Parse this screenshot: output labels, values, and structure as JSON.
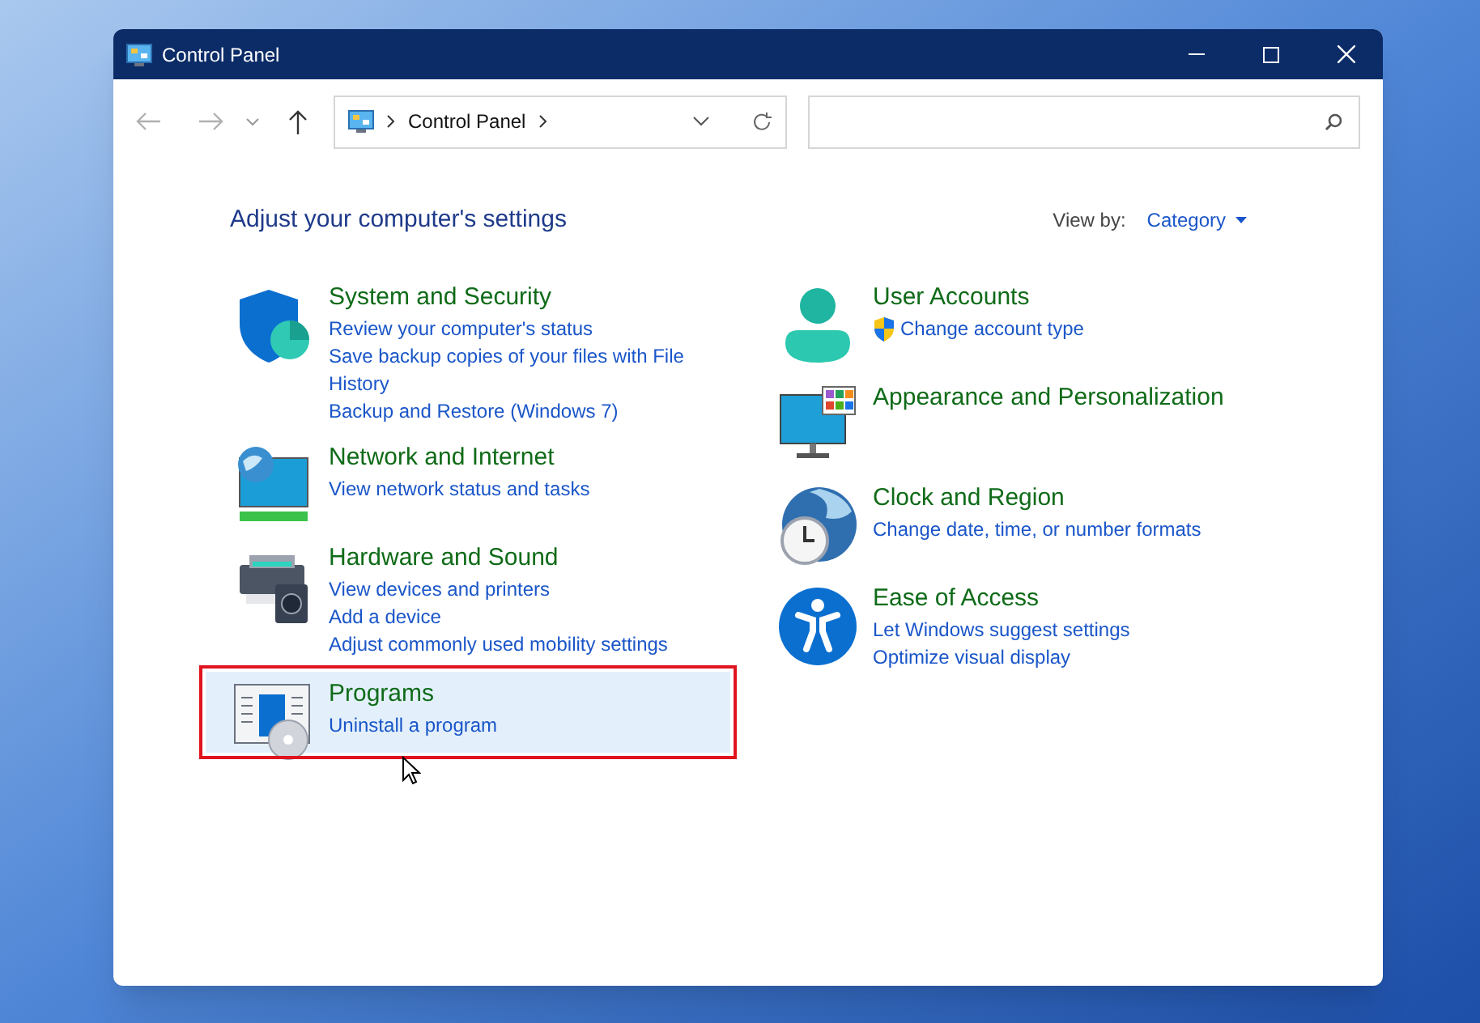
{
  "window": {
    "title": "Control Panel"
  },
  "address_bar": {
    "path": "Control Panel"
  },
  "heading": "Adjust your computer's settings",
  "view_by": {
    "label": "View by:",
    "value": "Category"
  },
  "columns": [
    {
      "categories": [
        {
          "title": "System and Security",
          "selected": false,
          "links": [
            {
              "text": "Review your computer's status",
              "shield": false
            },
            {
              "text": "Save backup copies of your files with File History",
              "shield": false
            },
            {
              "text": "Backup and Restore (Windows 7)",
              "shield": false
            }
          ]
        },
        {
          "title": "Network and Internet",
          "selected": false,
          "links": [
            {
              "text": "View network status and tasks",
              "shield": false
            }
          ]
        },
        {
          "title": "Hardware and Sound",
          "selected": false,
          "links": [
            {
              "text": "View devices and printers",
              "shield": false
            },
            {
              "text": "Add a device",
              "shield": false
            },
            {
              "text": "Adjust commonly used mobility settings",
              "shield": false
            }
          ]
        },
        {
          "title": "Programs",
          "selected": true,
          "links": [
            {
              "text": "Uninstall a program",
              "shield": false
            }
          ]
        }
      ]
    },
    {
      "categories": [
        {
          "title": "User Accounts",
          "selected": false,
          "links": [
            {
              "text": "Change account type",
              "shield": true
            }
          ]
        },
        {
          "title": "Appearance and Personalization",
          "selected": false
        },
        {
          "title": "Clock and Region",
          "selected": false,
          "links": [
            {
              "text": "Change date, time, or number formats",
              "shield": false
            }
          ]
        },
        {
          "title": "Ease of Access",
          "selected": false,
          "links": [
            {
              "text": "Let Windows suggest settings",
              "shield": false
            },
            {
              "text": "Optimize visual display",
              "shield": false
            }
          ]
        }
      ]
    }
  ]
}
